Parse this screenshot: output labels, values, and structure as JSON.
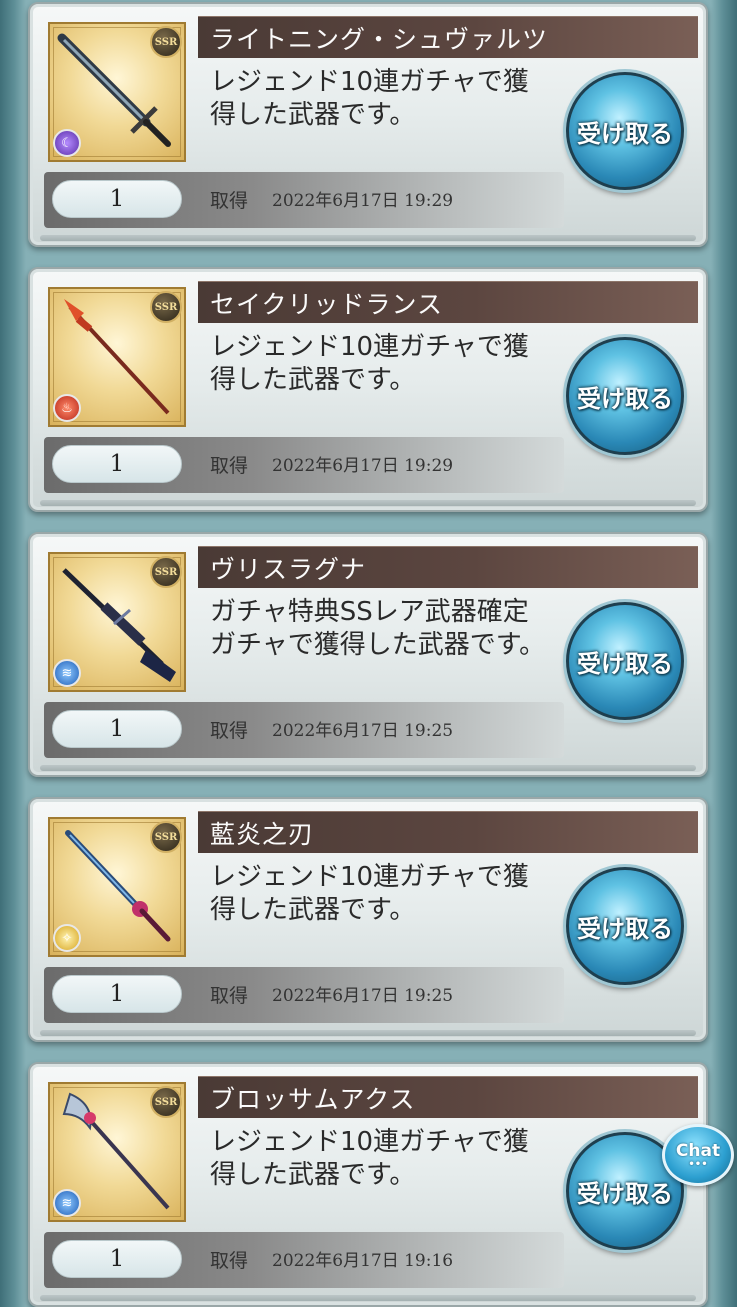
{
  "colors": {
    "name_bar": "#4a3a35",
    "receive_button": "#2a88b6",
    "background": "#86b0b6"
  },
  "items": [
    {
      "name": "ライトニング・シュヴァルツ",
      "description": "レジェンド10連ガチャで獲得した武器です。",
      "count": "1",
      "acquired_label": "取得",
      "acquired_date": "2022年6月17日 19:29",
      "receive_label": "受け取る",
      "rarity": "SSR",
      "element": "dark",
      "element_icon": "dark-element-icon",
      "weapon_icon": "sword-icon"
    },
    {
      "name": "セイクリッドランス",
      "description": "レジェンド10連ガチャで獲得した武器です。",
      "count": "1",
      "acquired_label": "取得",
      "acquired_date": "2022年6月17日 19:29",
      "receive_label": "受け取る",
      "rarity": "SSR",
      "element": "fire",
      "element_icon": "fire-element-icon",
      "weapon_icon": "spear-icon"
    },
    {
      "name": "ヴリスラグナ",
      "description": "ガチャ特典SSレア武器確定ガチャで獲得した武器です。",
      "count": "1",
      "acquired_label": "取得",
      "acquired_date": "2022年6月17日 19:25",
      "receive_label": "受け取る",
      "rarity": "SSR",
      "element": "water",
      "element_icon": "water-element-icon",
      "weapon_icon": "gun-icon"
    },
    {
      "name": "藍炎之刃",
      "description": "レジェンド10連ガチャで獲得した武器です。",
      "count": "1",
      "acquired_label": "取得",
      "acquired_date": "2022年6月17日 19:25",
      "receive_label": "受け取る",
      "rarity": "SSR",
      "element": "light",
      "element_icon": "light-element-icon",
      "weapon_icon": "katana-icon"
    },
    {
      "name": "ブロッサムアクス",
      "description": "レジェンド10連ガチャで獲得した武器です。",
      "count": "1",
      "acquired_label": "取得",
      "acquired_date": "2022年6月17日 19:16",
      "receive_label": "受け取る",
      "rarity": "SSR",
      "element": "water",
      "element_icon": "water-element-icon",
      "weapon_icon": "axe-icon"
    }
  ],
  "chat": {
    "label": "Chat",
    "dots": "•••"
  }
}
